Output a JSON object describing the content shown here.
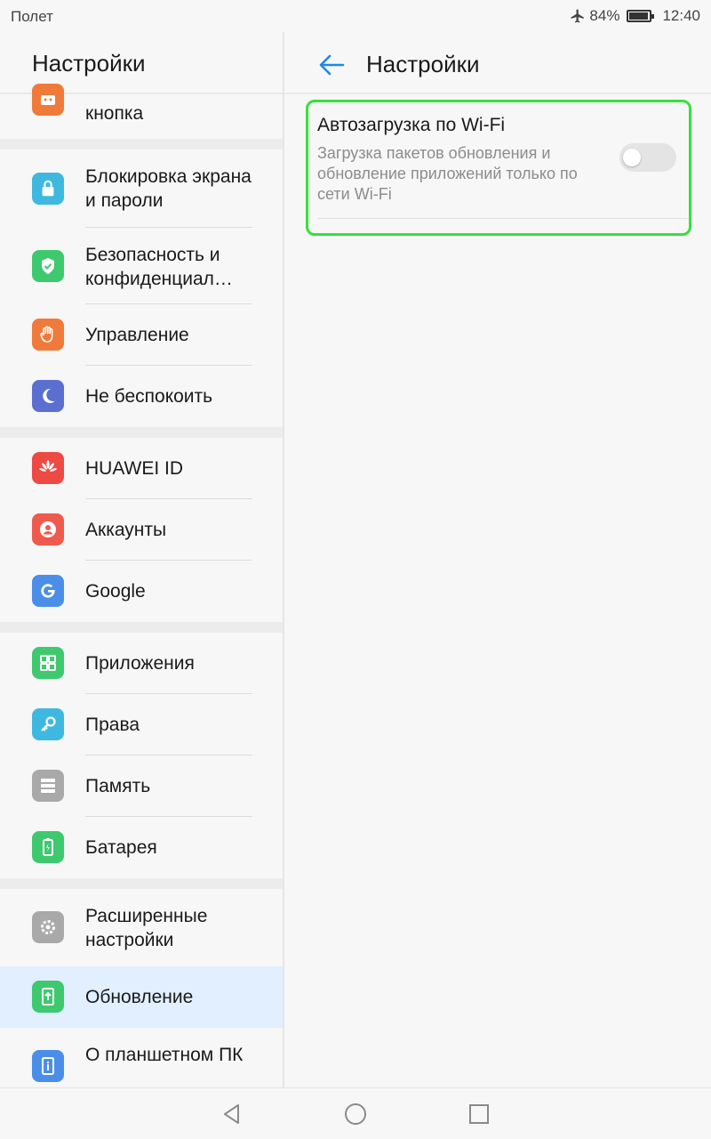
{
  "status_bar": {
    "carrier": "Полет",
    "battery_percent": "84%",
    "battery_level": 0.84,
    "time": "12:40",
    "icons": [
      "airplane-icon",
      "battery-icon"
    ]
  },
  "left_pane": {
    "title": "Настройки",
    "items": [
      {
        "label": "кнопка",
        "icon": "robot-icon",
        "color": "#f07a3a"
      },
      {
        "label": "Блокировка экрана и пароли",
        "icon": "lock-icon",
        "color": "#3fb8e0"
      },
      {
        "label": "Безопасность и конфиденциал…",
        "icon": "shield-icon",
        "color": "#3ec96f"
      },
      {
        "label": "Управление",
        "icon": "hand-icon",
        "color": "#f07a3a"
      },
      {
        "label": "Не беспокоить",
        "icon": "moon-icon",
        "color": "#5b6fd1"
      },
      {
        "label": "HUAWEI ID",
        "icon": "huawei-icon",
        "color": "#ee4a44"
      },
      {
        "label": "Аккаунты",
        "icon": "account-icon",
        "color": "#ee5b4e"
      },
      {
        "label": "Google",
        "icon": "google-icon",
        "color": "#4a8ee8"
      },
      {
        "label": "Приложения",
        "icon": "apps-icon",
        "color": "#3ec96f"
      },
      {
        "label": "Права",
        "icon": "key-icon",
        "color": "#3fb8e0"
      },
      {
        "label": "Память",
        "icon": "storage-icon",
        "color": "#a9a9a9"
      },
      {
        "label": "Батарея",
        "icon": "battery-icon",
        "color": "#3ec96f"
      },
      {
        "label": "Расширенные настройки",
        "icon": "gear-icon",
        "color": "#a9a9a9"
      },
      {
        "label": "Обновление",
        "icon": "update-icon",
        "color": "#3ec96f",
        "selected": true
      },
      {
        "label": "О планшетном ПК",
        "icon": "info-icon",
        "color": "#4a8ee8"
      }
    ]
  },
  "right_pane": {
    "title": "Настройки",
    "setting": {
      "title": "Автозагрузка по Wi-Fi",
      "description": "Загрузка пакетов обновления и обновление приложений только по сети Wi-Fi",
      "enabled": false
    },
    "highlight_color": "#35e13a"
  },
  "nav_bar": {
    "icons": [
      "back-icon",
      "home-icon",
      "recents-icon"
    ]
  }
}
